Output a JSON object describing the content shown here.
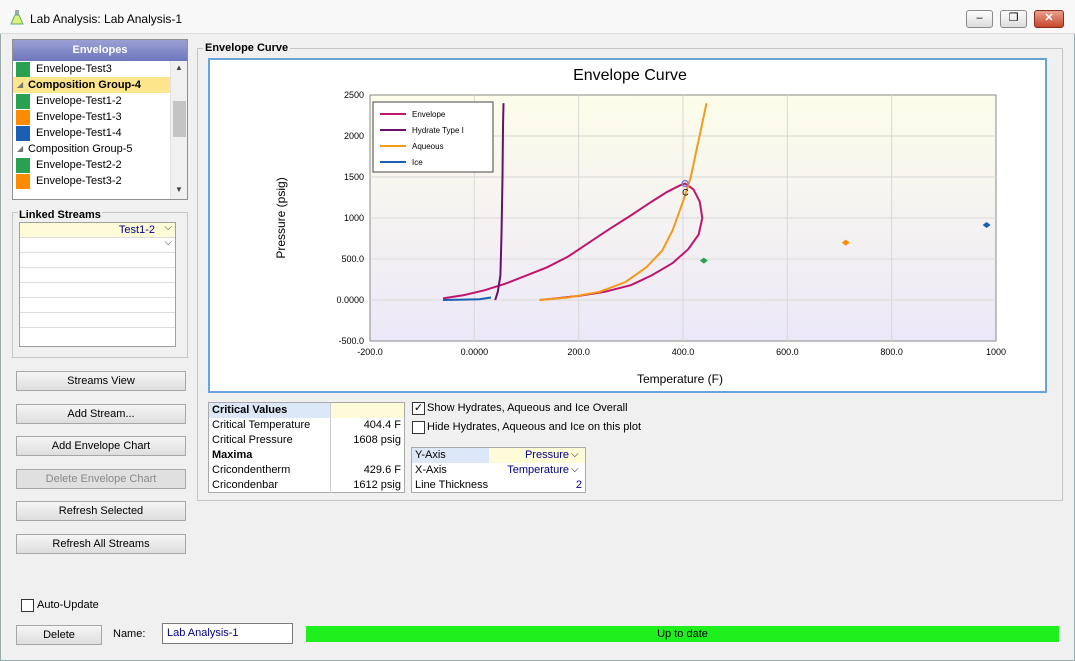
{
  "window": {
    "title": "Lab Analysis: Lab Analysis-1",
    "minimize": "–",
    "restore": "❐",
    "close": "✕"
  },
  "envelopes": {
    "header": "Envelopes",
    "items": [
      {
        "label": "Envelope-Test3",
        "color": "#2aa14f",
        "group": false
      },
      {
        "label": "Composition Group-4",
        "group": true,
        "selected": true
      },
      {
        "label": "Envelope-Test1-2",
        "color": "#2aa14f",
        "group": false
      },
      {
        "label": "Envelope-Test1-3",
        "color": "#ff8c00",
        "group": false
      },
      {
        "label": "Envelope-Test1-4",
        "color": "#1a5fb4",
        "group": false
      },
      {
        "label": "Composition Group-5",
        "group": true
      },
      {
        "label": "Envelope-Test2-2",
        "color": "#2aa14f",
        "group": false
      },
      {
        "label": "Envelope-Test3-2",
        "color": "#ff8c00",
        "group": false
      }
    ]
  },
  "linked_streams": {
    "title": "Linked Streams",
    "rows": [
      "Test1-2",
      ""
    ]
  },
  "buttons": {
    "streams_view": "Streams View",
    "add_stream": "Add Stream...",
    "add_envelope_chart": "Add Envelope Chart",
    "delete_envelope_chart": "Delete Envelope Chart",
    "refresh_selected": "Refresh Selected",
    "refresh_all": "Refresh All Streams",
    "delete": "Delete"
  },
  "envelope_curve_group": "Envelope Curve",
  "chart_data": {
    "type": "line",
    "title": "Envelope Curve",
    "xlabel": "Temperature (F)",
    "ylabel": "Pressure (psig)",
    "xlim": [
      -200,
      1000
    ],
    "ylim": [
      -500,
      2500
    ],
    "x_ticks": [
      "-200.0",
      "0.0000",
      "200.0",
      "400.0",
      "600.0",
      "800.0",
      "1000"
    ],
    "y_ticks": [
      "2500",
      "2000",
      "1500",
      "1000",
      "500.0",
      "0.0000",
      "-500.0"
    ],
    "legend_placement": "top-left",
    "critical_marker": "C",
    "series": [
      {
        "name": "Envelope",
        "color": "#c0156e",
        "x": [
          -60,
          -20,
          20,
          60,
          100,
          140,
          180,
          220,
          260,
          300,
          340,
          370,
          395,
          404,
          420,
          432,
          437,
          430,
          410,
          380,
          340,
          300,
          250,
          200,
          150,
          125
        ],
        "y": [
          20,
          60,
          120,
          200,
          300,
          400,
          530,
          700,
          870,
          1030,
          1200,
          1320,
          1400,
          1420,
          1350,
          1200,
          1000,
          800,
          620,
          450,
          300,
          180,
          100,
          50,
          15,
          0
        ]
      },
      {
        "name": "Hydrate Type I",
        "color": "#6b0f6e",
        "x": [
          40,
          45,
          50,
          52,
          54,
          55,
          56
        ],
        "y": [
          0,
          100,
          300,
          800,
          1500,
          2100,
          2400
        ]
      },
      {
        "name": "Aqueous",
        "color": "#f59a16",
        "x": [
          125,
          180,
          240,
          290,
          330,
          360,
          380,
          400,
          415,
          425,
          435,
          445
        ],
        "y": [
          0,
          30,
          100,
          220,
          400,
          600,
          850,
          1200,
          1500,
          1800,
          2100,
          2400
        ]
      },
      {
        "name": "Ice",
        "color": "#1a5fb4",
        "x": [
          -60,
          -20,
          10,
          32
        ],
        "y": [
          0,
          5,
          10,
          30
        ]
      }
    ],
    "points": [
      {
        "x": 440,
        "y": 480,
        "color": "#2aa14f"
      },
      {
        "x": 712,
        "y": 700,
        "color": "#ff8c00"
      },
      {
        "x": 982,
        "y": 915,
        "color": "#1a5fb4"
      }
    ]
  },
  "critical_values": {
    "header": "Critical Values",
    "rows": [
      {
        "label": "Critical Temperature",
        "value": "404.4 F"
      },
      {
        "label": "Critical Pressure",
        "value": "1608 psig"
      }
    ],
    "maxima_header": "Maxima",
    "maxima": [
      {
        "label": "Cricondentherm",
        "value": "429.6 F"
      },
      {
        "label": "Cricondenbar",
        "value": "1612 psig"
      }
    ]
  },
  "options": {
    "show_overall": {
      "label": "Show Hydrates, Aqueous and Ice Overall",
      "checked": "✓"
    },
    "hide_plot": {
      "label": "Hide Hydrates, Aqueous and Ice on this plot",
      "checked": ""
    }
  },
  "axes_table": [
    {
      "label": "Y-Axis",
      "value": "Pressure"
    },
    {
      "label": "X-Axis",
      "value": "Temperature"
    },
    {
      "label": "Line Thickness",
      "value": "2"
    }
  ],
  "auto_update": {
    "label": "Auto-Update",
    "checked": ""
  },
  "name_field": {
    "label": "Name:",
    "value": "Lab Analysis-1"
  },
  "status": "Up to date"
}
